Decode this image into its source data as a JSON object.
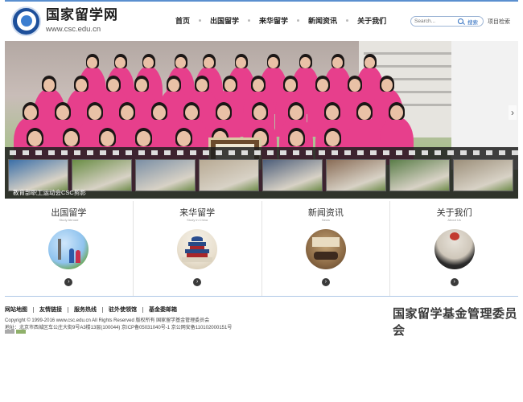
{
  "header": {
    "logo_cn": "国家留学网",
    "logo_url": "www.csc.edu.cn",
    "nav": [
      "首页",
      "出国留学",
      "来华留学",
      "新闻资讯",
      "关于我们"
    ],
    "search_placeholder": "Search...",
    "search_button": "搜索",
    "advanced_search": "项目检索"
  },
  "banner": {
    "caption": "教育部职工运动会CSC剪影"
  },
  "columns": [
    {
      "title": "出国留学",
      "subtitle": "Study Abroad"
    },
    {
      "title": "来华留学",
      "subtitle": "Study in China"
    },
    {
      "title": "新闻资讯",
      "subtitle": "News"
    },
    {
      "title": "关于我们",
      "subtitle": "About Us"
    }
  ],
  "footer": {
    "links": [
      "网站地图",
      "友情链接",
      "服务热线",
      "驻外使领馆",
      "基金委邮箱"
    ],
    "copyright": "Copyright © 1999-2016 www.csc.edu.cn All Rights Reserved   版权所有  国家留学基金管理委员会",
    "address": "地址：北京市西城区车公庄大街9号A3楼13层(100044)   京ICP备05031040号-1    京公网安备110102000151号",
    "signature": "国家留学基金管理委员会"
  },
  "colors": {
    "accent": "#5a8fcf",
    "banner_shirts": "#e73f8c"
  }
}
